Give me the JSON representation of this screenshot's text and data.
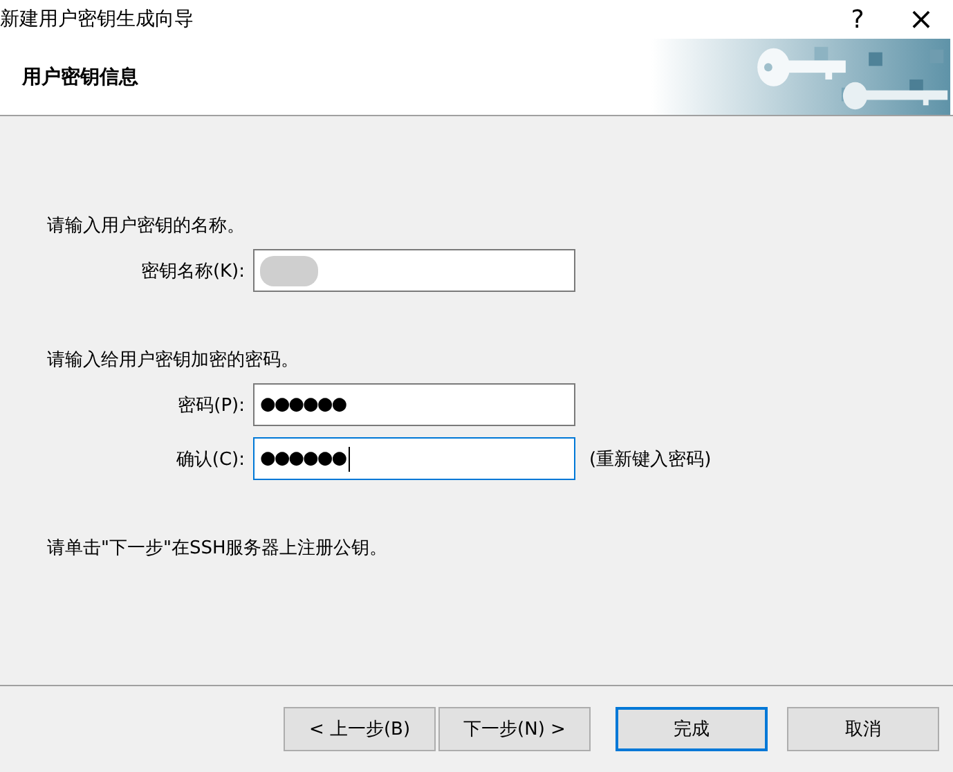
{
  "window": {
    "title": "新建用户密钥生成向导",
    "help": "?",
    "close": "×"
  },
  "header": {
    "title": "用户密钥信息"
  },
  "name_section": {
    "prompt": "请输入用户密钥的名称。",
    "label": "密钥名称(K):",
    "redacted": true
  },
  "password_section": {
    "prompt": "请输入给用户密钥加密的密码。",
    "fields": [
      {
        "label": "密码(P):",
        "value": "●●●●●●",
        "focused": false
      },
      {
        "label": "确认(C):",
        "value": "●●●●●●",
        "focused": true,
        "hint": "(重新键入密码)"
      }
    ]
  },
  "note": "请单击\"下一步\"在SSH服务器上注册公钥。",
  "buttons": [
    {
      "label": "< 上一步(B)",
      "default": false
    },
    {
      "label": "下一步(N) >",
      "default": false
    },
    {
      "label": "完成",
      "default": true
    },
    {
      "label": "取消",
      "default": false
    }
  ]
}
